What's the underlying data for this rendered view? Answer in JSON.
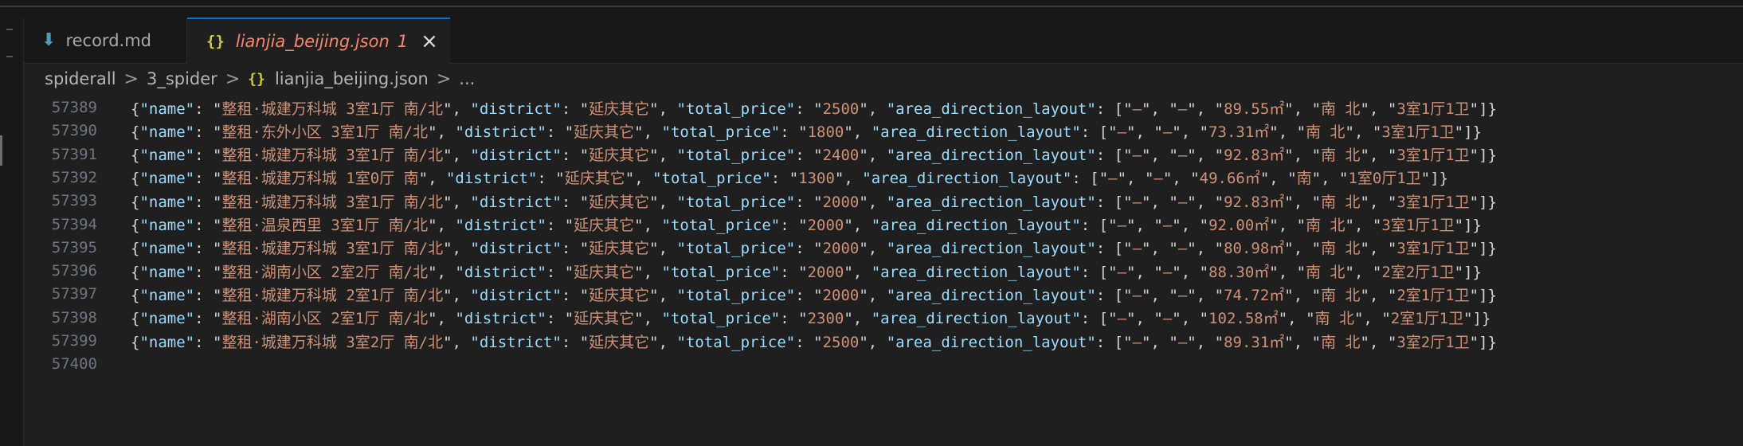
{
  "tabs": [
    {
      "label": "record.md",
      "icon": "markdown-icon",
      "active": false
    },
    {
      "label": "lianjia_beijing.json",
      "icon": "json-braces-icon",
      "active": true,
      "problems": "1"
    }
  ],
  "breadcrumb": {
    "folder1": "spiderall",
    "folder2": "3_spider",
    "file": "lianjia_beijing.json",
    "tail": "..."
  },
  "icons": {
    "json_braces": "{}",
    "close": "×",
    "separator": ">"
  },
  "colors": {
    "accent": "#0078d4",
    "key": "#9cdcfe",
    "string": "#ce9178",
    "error": "#f48771",
    "line_number": "#6e7681"
  },
  "editor": {
    "lines": [
      {
        "num": "57389",
        "name": "整租·城建万科城 3室1厅 南/北",
        "district": "延庆其它",
        "price": "2500",
        "layout": [
          "–",
          "–",
          "89.55㎡",
          "南 北",
          "3室1厅1卫"
        ]
      },
      {
        "num": "57390",
        "name": "整租·东外小区 3室1厅 南/北",
        "district": "延庆其它",
        "price": "1800",
        "layout": [
          "–",
          "–",
          "73.31㎡",
          "南 北",
          "3室1厅1卫"
        ]
      },
      {
        "num": "57391",
        "name": "整租·城建万科城 3室1厅 南/北",
        "district": "延庆其它",
        "price": "2400",
        "layout": [
          "–",
          "–",
          "92.83㎡",
          "南 北",
          "3室1厅1卫"
        ]
      },
      {
        "num": "57392",
        "name": "整租·城建万科城 1室0厅 南",
        "district": "延庆其它",
        "price": "1300",
        "layout": [
          "–",
          "–",
          "49.66㎡",
          "南",
          "1室0厅1卫"
        ]
      },
      {
        "num": "57393",
        "name": "整租·城建万科城 3室1厅 南/北",
        "district": "延庆其它",
        "price": "2000",
        "layout": [
          "–",
          "–",
          "92.83㎡",
          "南 北",
          "3室1厅1卫"
        ]
      },
      {
        "num": "57394",
        "name": "整租·温泉西里 3室1厅 南/北",
        "district": "延庆其它",
        "price": "2000",
        "layout": [
          "–",
          "–",
          "92.00㎡",
          "南 北",
          "3室1厅1卫"
        ]
      },
      {
        "num": "57395",
        "name": "整租·城建万科城 3室1厅 南/北",
        "district": "延庆其它",
        "price": "2000",
        "layout": [
          "–",
          "–",
          "80.98㎡",
          "南 北",
          "3室1厅1卫"
        ]
      },
      {
        "num": "57396",
        "name": "整租·湖南小区 2室2厅 南/北",
        "district": "延庆其它",
        "price": "2000",
        "layout": [
          "–",
          "–",
          "88.30㎡",
          "南 北",
          "2室2厅1卫"
        ]
      },
      {
        "num": "57397",
        "name": "整租·城建万科城 2室1厅 南/北",
        "district": "延庆其它",
        "price": "2000",
        "layout": [
          "–",
          "–",
          "74.72㎡",
          "南 北",
          "2室1厅1卫"
        ]
      },
      {
        "num": "57398",
        "name": "整租·湖南小区 2室1厅 南/北",
        "district": "延庆其它",
        "price": "2300",
        "layout": [
          "–",
          "–",
          "102.58㎡",
          "南 北",
          "2室1厅1卫"
        ]
      },
      {
        "num": "57399",
        "name": "整租·城建万科城 3室2厅 南/北",
        "district": "延庆其它",
        "price": "2500",
        "layout": [
          "–",
          "–",
          "89.31㎡",
          "南 北",
          "3室2厅1卫"
        ]
      },
      {
        "num": "57400"
      }
    ]
  }
}
